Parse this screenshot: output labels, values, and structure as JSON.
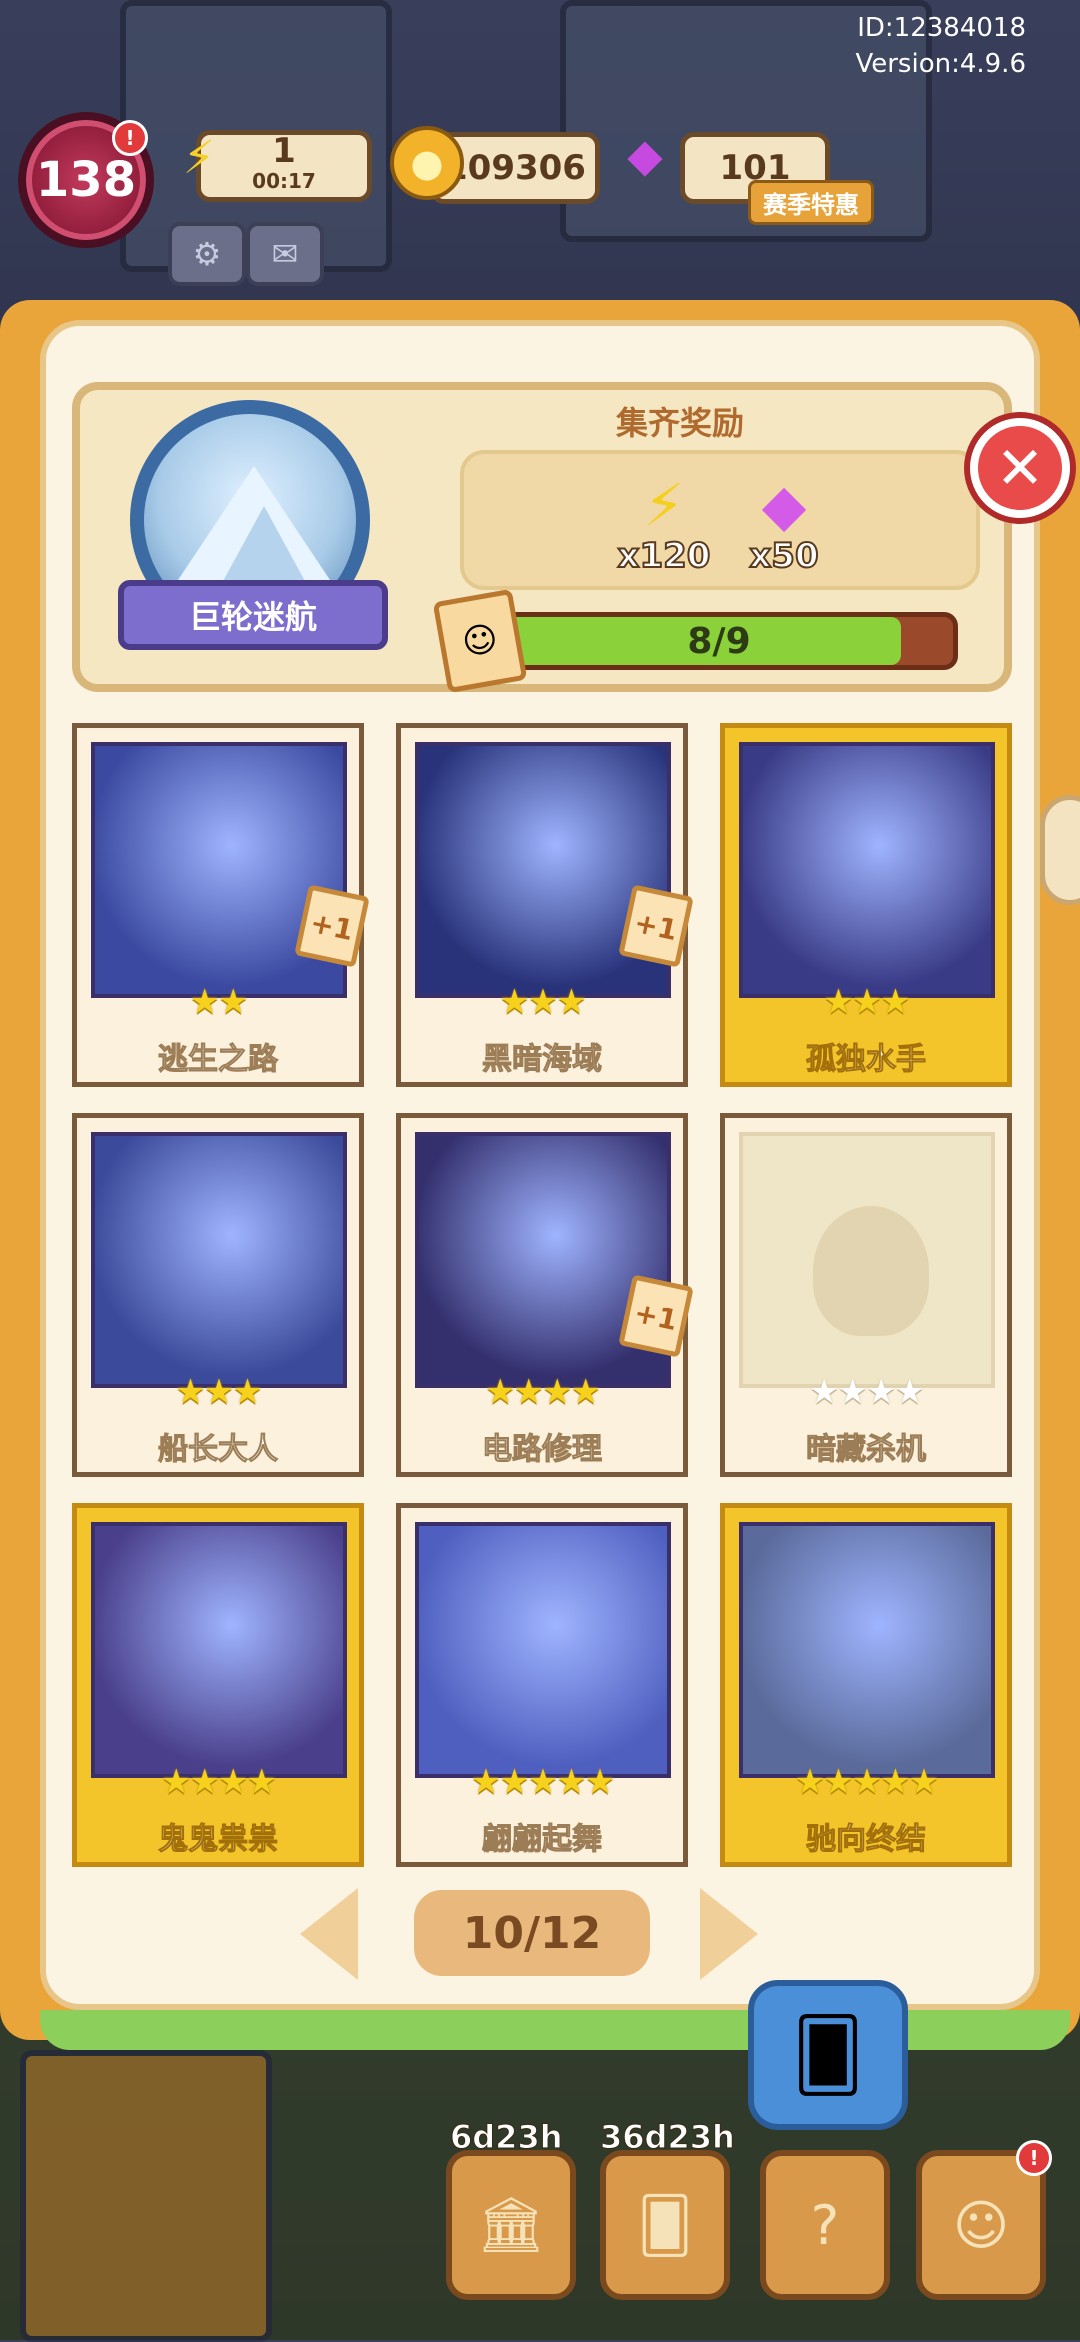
{
  "topinfo": {
    "id": "ID:12384018",
    "version": "Version:4.9.6"
  },
  "hud": {
    "level": "138",
    "energy_value": "1",
    "energy_timer": "00:17",
    "coins": "109306",
    "gems": "101",
    "season_label": "赛季特惠"
  },
  "album": {
    "chapter_name": "巨轮迷航",
    "reward_title": "集齐奖励",
    "rewards": [
      {
        "icon": "lightning-icon",
        "amount": "x120"
      },
      {
        "icon": "gem-icon",
        "amount": "x50"
      }
    ],
    "progress_text": "8/9",
    "progress_fraction": 0.889
  },
  "cards": [
    {
      "name": "逃生之路",
      "stars": 2,
      "max_stars": 2,
      "gold": false,
      "extra": "+1",
      "collected": true
    },
    {
      "name": "黑暗海域",
      "stars": 3,
      "max_stars": 3,
      "gold": false,
      "extra": "+1",
      "collected": true
    },
    {
      "name": "孤独水手",
      "stars": 3,
      "max_stars": 3,
      "gold": true,
      "extra": "",
      "collected": true
    },
    {
      "name": "船长大人",
      "stars": 3,
      "max_stars": 3,
      "gold": false,
      "extra": "",
      "collected": true
    },
    {
      "name": "电路修理",
      "stars": 4,
      "max_stars": 4,
      "gold": false,
      "extra": "+1",
      "collected": true
    },
    {
      "name": "暗藏杀机",
      "stars": 0,
      "max_stars": 4,
      "gold": false,
      "extra": "",
      "collected": false
    },
    {
      "name": "鬼鬼祟祟",
      "stars": 4,
      "max_stars": 4,
      "gold": true,
      "extra": "",
      "collected": true
    },
    {
      "name": "翩翩起舞",
      "stars": 5,
      "max_stars": 5,
      "gold": false,
      "extra": "",
      "collected": true
    },
    {
      "name": "驰向终结",
      "stars": 5,
      "max_stars": 5,
      "gold": true,
      "extra": "",
      "collected": true
    }
  ],
  "pager": {
    "current": "10/12"
  },
  "dock": {
    "timer1": "6d23h",
    "timer2": "36d23h"
  },
  "colors": {
    "accent_gold": "#f3c52a",
    "progress_green": "#8ad13a",
    "close_red": "#e94a4a"
  }
}
